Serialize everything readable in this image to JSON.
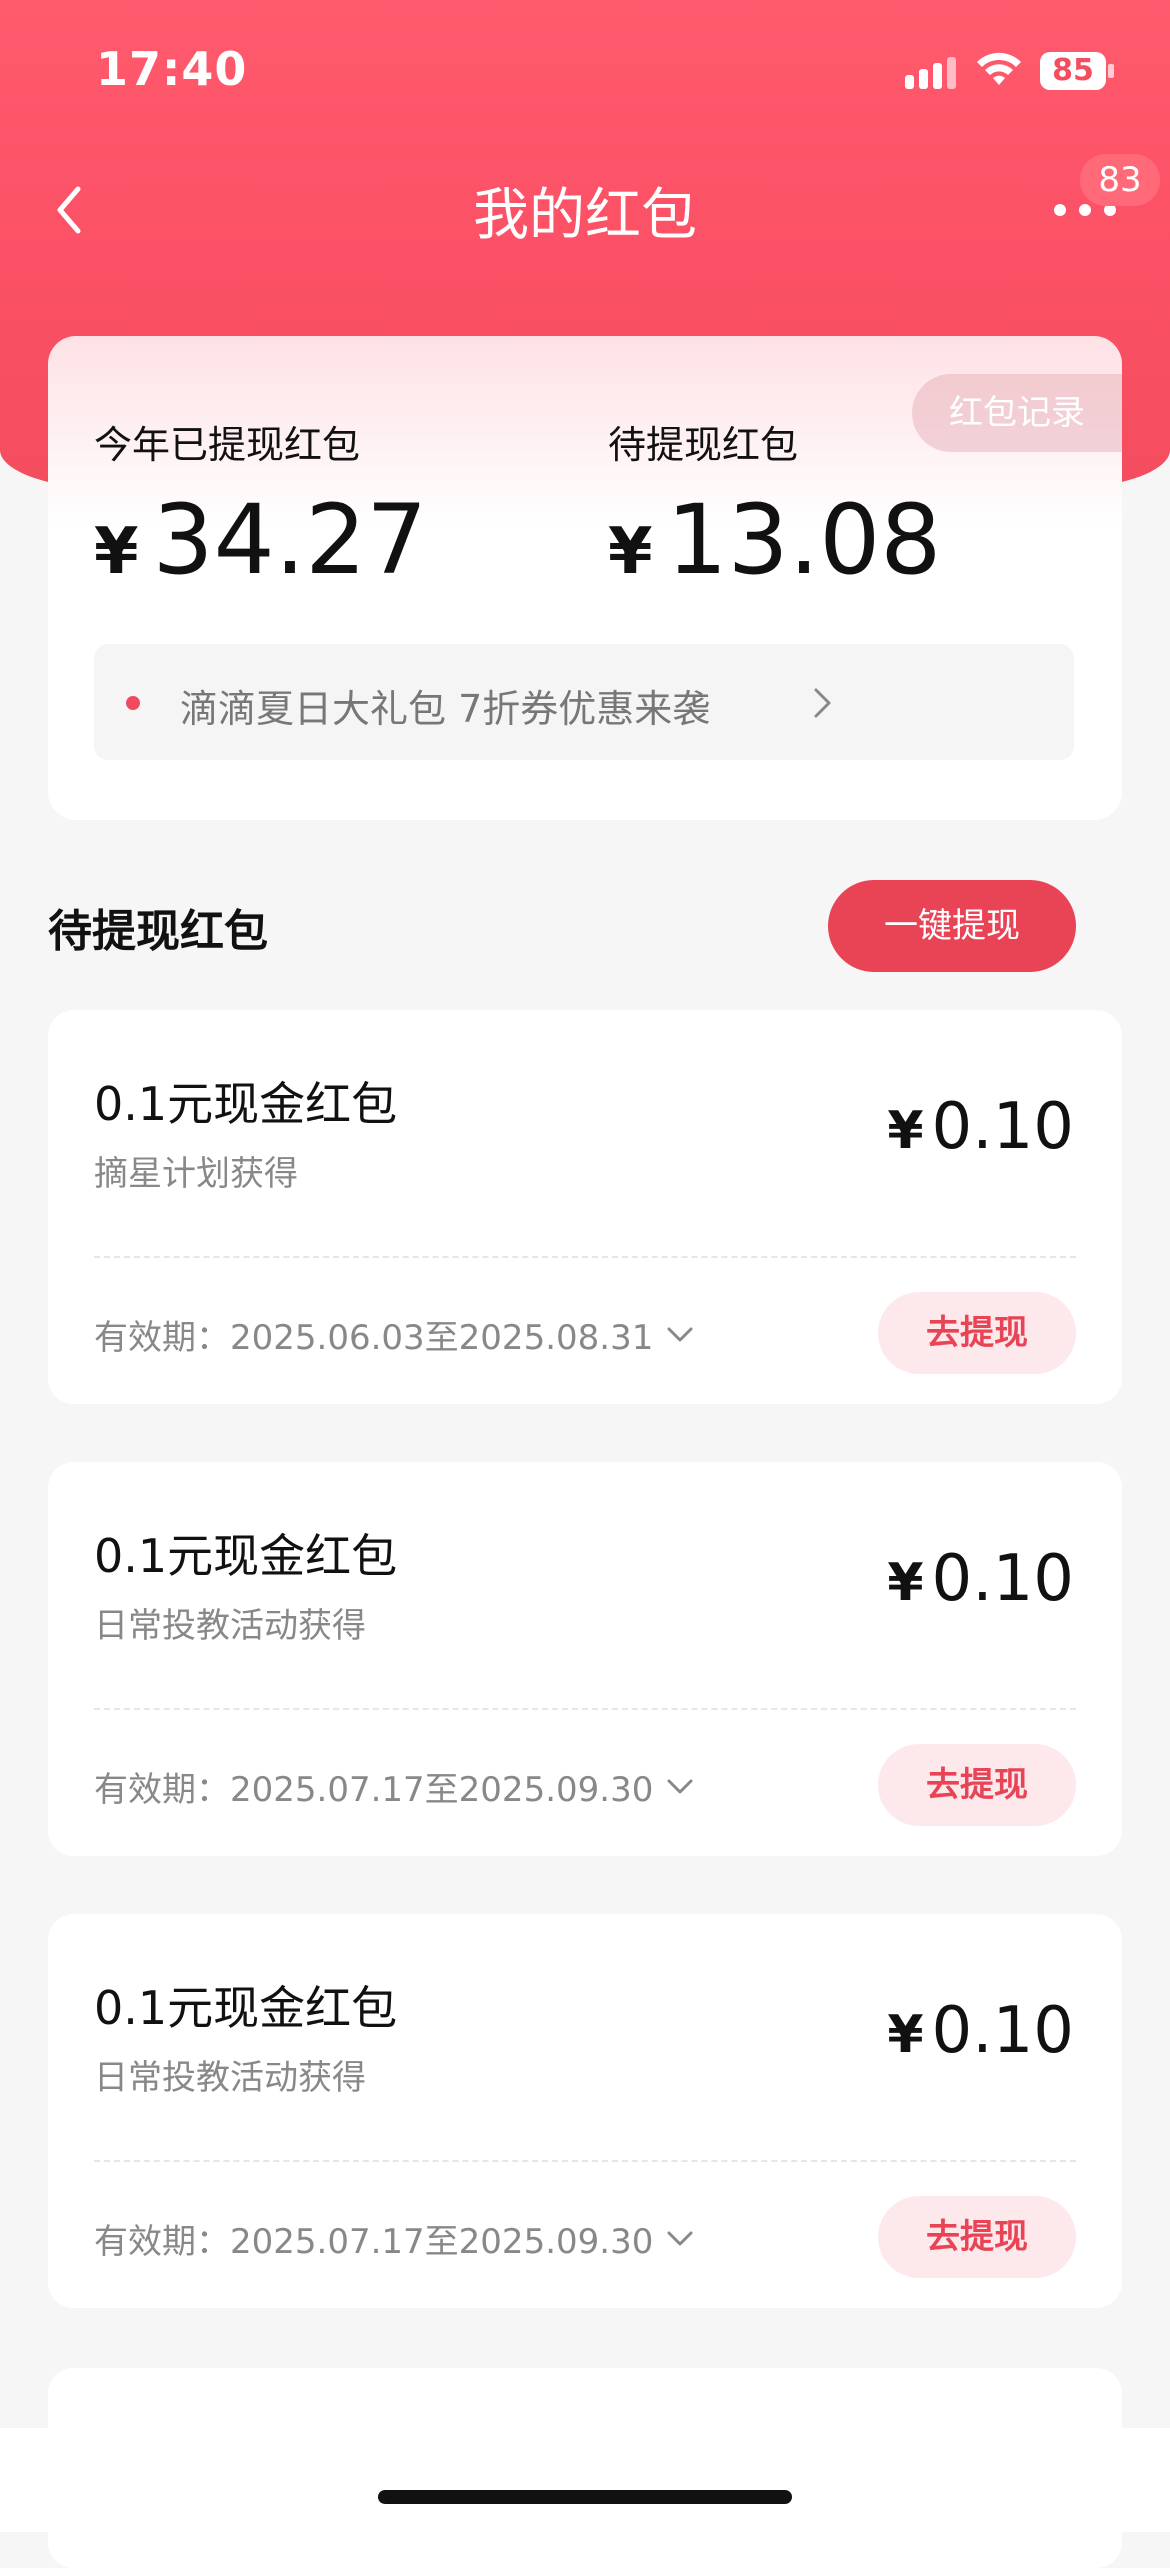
{
  "status_bar": {
    "time": "17:40",
    "battery": "85"
  },
  "nav": {
    "title": "我的红包",
    "badge": "83"
  },
  "summary": {
    "record_button": "红包记录",
    "withdrawn_label": "今年已提现红包",
    "withdrawn_currency": "¥",
    "withdrawn_amount": "34.27",
    "pending_label": "待提现红包",
    "pending_currency": "¥",
    "pending_amount": "13.08",
    "promo_text": "滴滴夏日大礼包 7折券优惠来袭"
  },
  "section": {
    "title": "待提现红包",
    "withdraw_all_button": "一键提现"
  },
  "envelopes": [
    {
      "title": "0.1元现金红包",
      "source": "摘星计划获得",
      "currency": "¥",
      "amount": "0.10",
      "validity": "有效期：2025.06.03至2025.08.31",
      "button": "去提现"
    },
    {
      "title": "0.1元现金红包",
      "source": "日常投教活动获得",
      "currency": "¥",
      "amount": "0.10",
      "validity": "有效期：2025.07.17至2025.09.30",
      "button": "去提现"
    },
    {
      "title": "0.1元现金红包",
      "source": "日常投教活动获得",
      "currency": "¥",
      "amount": "0.10",
      "validity": "有效期：2025.07.17至2025.09.30",
      "button": "去提现"
    }
  ],
  "colors": {
    "brand": "#f44d5f",
    "button_red": "#e94456",
    "button_pink_bg": "#fde9ec"
  },
  "icons": {
    "back": "chevron-left-icon",
    "more": "more-dots-icon",
    "promo": "chevron-right-icon",
    "validity": "chevron-down-icon"
  }
}
